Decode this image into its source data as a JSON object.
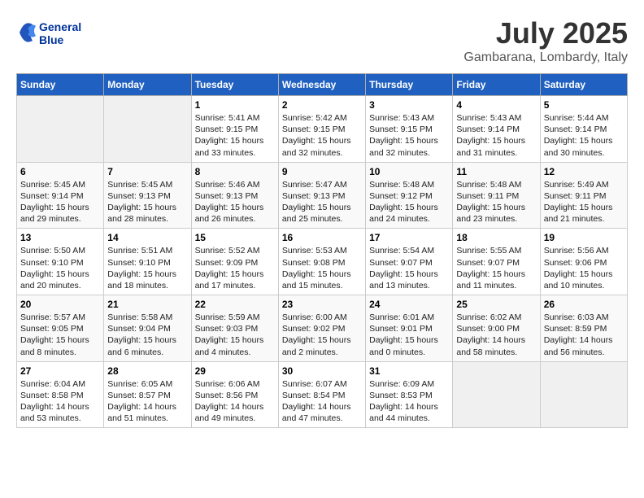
{
  "header": {
    "logo_line1": "General",
    "logo_line2": "Blue",
    "month_year": "July 2025",
    "location": "Gambarana, Lombardy, Italy"
  },
  "weekdays": [
    "Sunday",
    "Monday",
    "Tuesday",
    "Wednesday",
    "Thursday",
    "Friday",
    "Saturday"
  ],
  "weeks": [
    [
      {
        "day": "",
        "empty": true
      },
      {
        "day": "",
        "empty": true
      },
      {
        "day": "1",
        "sunrise": "Sunrise: 5:41 AM",
        "sunset": "Sunset: 9:15 PM",
        "daylight": "Daylight: 15 hours and 33 minutes."
      },
      {
        "day": "2",
        "sunrise": "Sunrise: 5:42 AM",
        "sunset": "Sunset: 9:15 PM",
        "daylight": "Daylight: 15 hours and 32 minutes."
      },
      {
        "day": "3",
        "sunrise": "Sunrise: 5:43 AM",
        "sunset": "Sunset: 9:15 PM",
        "daylight": "Daylight: 15 hours and 32 minutes."
      },
      {
        "day": "4",
        "sunrise": "Sunrise: 5:43 AM",
        "sunset": "Sunset: 9:14 PM",
        "daylight": "Daylight: 15 hours and 31 minutes."
      },
      {
        "day": "5",
        "sunrise": "Sunrise: 5:44 AM",
        "sunset": "Sunset: 9:14 PM",
        "daylight": "Daylight: 15 hours and 30 minutes."
      }
    ],
    [
      {
        "day": "6",
        "sunrise": "Sunrise: 5:45 AM",
        "sunset": "Sunset: 9:14 PM",
        "daylight": "Daylight: 15 hours and 29 minutes."
      },
      {
        "day": "7",
        "sunrise": "Sunrise: 5:45 AM",
        "sunset": "Sunset: 9:13 PM",
        "daylight": "Daylight: 15 hours and 28 minutes."
      },
      {
        "day": "8",
        "sunrise": "Sunrise: 5:46 AM",
        "sunset": "Sunset: 9:13 PM",
        "daylight": "Daylight: 15 hours and 26 minutes."
      },
      {
        "day": "9",
        "sunrise": "Sunrise: 5:47 AM",
        "sunset": "Sunset: 9:13 PM",
        "daylight": "Daylight: 15 hours and 25 minutes."
      },
      {
        "day": "10",
        "sunrise": "Sunrise: 5:48 AM",
        "sunset": "Sunset: 9:12 PM",
        "daylight": "Daylight: 15 hours and 24 minutes."
      },
      {
        "day": "11",
        "sunrise": "Sunrise: 5:48 AM",
        "sunset": "Sunset: 9:11 PM",
        "daylight": "Daylight: 15 hours and 23 minutes."
      },
      {
        "day": "12",
        "sunrise": "Sunrise: 5:49 AM",
        "sunset": "Sunset: 9:11 PM",
        "daylight": "Daylight: 15 hours and 21 minutes."
      }
    ],
    [
      {
        "day": "13",
        "sunrise": "Sunrise: 5:50 AM",
        "sunset": "Sunset: 9:10 PM",
        "daylight": "Daylight: 15 hours and 20 minutes."
      },
      {
        "day": "14",
        "sunrise": "Sunrise: 5:51 AM",
        "sunset": "Sunset: 9:10 PM",
        "daylight": "Daylight: 15 hours and 18 minutes."
      },
      {
        "day": "15",
        "sunrise": "Sunrise: 5:52 AM",
        "sunset": "Sunset: 9:09 PM",
        "daylight": "Daylight: 15 hours and 17 minutes."
      },
      {
        "day": "16",
        "sunrise": "Sunrise: 5:53 AM",
        "sunset": "Sunset: 9:08 PM",
        "daylight": "Daylight: 15 hours and 15 minutes."
      },
      {
        "day": "17",
        "sunrise": "Sunrise: 5:54 AM",
        "sunset": "Sunset: 9:07 PM",
        "daylight": "Daylight: 15 hours and 13 minutes."
      },
      {
        "day": "18",
        "sunrise": "Sunrise: 5:55 AM",
        "sunset": "Sunset: 9:07 PM",
        "daylight": "Daylight: 15 hours and 11 minutes."
      },
      {
        "day": "19",
        "sunrise": "Sunrise: 5:56 AM",
        "sunset": "Sunset: 9:06 PM",
        "daylight": "Daylight: 15 hours and 10 minutes."
      }
    ],
    [
      {
        "day": "20",
        "sunrise": "Sunrise: 5:57 AM",
        "sunset": "Sunset: 9:05 PM",
        "daylight": "Daylight: 15 hours and 8 minutes."
      },
      {
        "day": "21",
        "sunrise": "Sunrise: 5:58 AM",
        "sunset": "Sunset: 9:04 PM",
        "daylight": "Daylight: 15 hours and 6 minutes."
      },
      {
        "day": "22",
        "sunrise": "Sunrise: 5:59 AM",
        "sunset": "Sunset: 9:03 PM",
        "daylight": "Daylight: 15 hours and 4 minutes."
      },
      {
        "day": "23",
        "sunrise": "Sunrise: 6:00 AM",
        "sunset": "Sunset: 9:02 PM",
        "daylight": "Daylight: 15 hours and 2 minutes."
      },
      {
        "day": "24",
        "sunrise": "Sunrise: 6:01 AM",
        "sunset": "Sunset: 9:01 PM",
        "daylight": "Daylight: 15 hours and 0 minutes."
      },
      {
        "day": "25",
        "sunrise": "Sunrise: 6:02 AM",
        "sunset": "Sunset: 9:00 PM",
        "daylight": "Daylight: 14 hours and 58 minutes."
      },
      {
        "day": "26",
        "sunrise": "Sunrise: 6:03 AM",
        "sunset": "Sunset: 8:59 PM",
        "daylight": "Daylight: 14 hours and 56 minutes."
      }
    ],
    [
      {
        "day": "27",
        "sunrise": "Sunrise: 6:04 AM",
        "sunset": "Sunset: 8:58 PM",
        "daylight": "Daylight: 14 hours and 53 minutes."
      },
      {
        "day": "28",
        "sunrise": "Sunrise: 6:05 AM",
        "sunset": "Sunset: 8:57 PM",
        "daylight": "Daylight: 14 hours and 51 minutes."
      },
      {
        "day": "29",
        "sunrise": "Sunrise: 6:06 AM",
        "sunset": "Sunset: 8:56 PM",
        "daylight": "Daylight: 14 hours and 49 minutes."
      },
      {
        "day": "30",
        "sunrise": "Sunrise: 6:07 AM",
        "sunset": "Sunset: 8:54 PM",
        "daylight": "Daylight: 14 hours and 47 minutes."
      },
      {
        "day": "31",
        "sunrise": "Sunrise: 6:09 AM",
        "sunset": "Sunset: 8:53 PM",
        "daylight": "Daylight: 14 hours and 44 minutes."
      },
      {
        "day": "",
        "empty": true
      },
      {
        "day": "",
        "empty": true
      }
    ]
  ]
}
